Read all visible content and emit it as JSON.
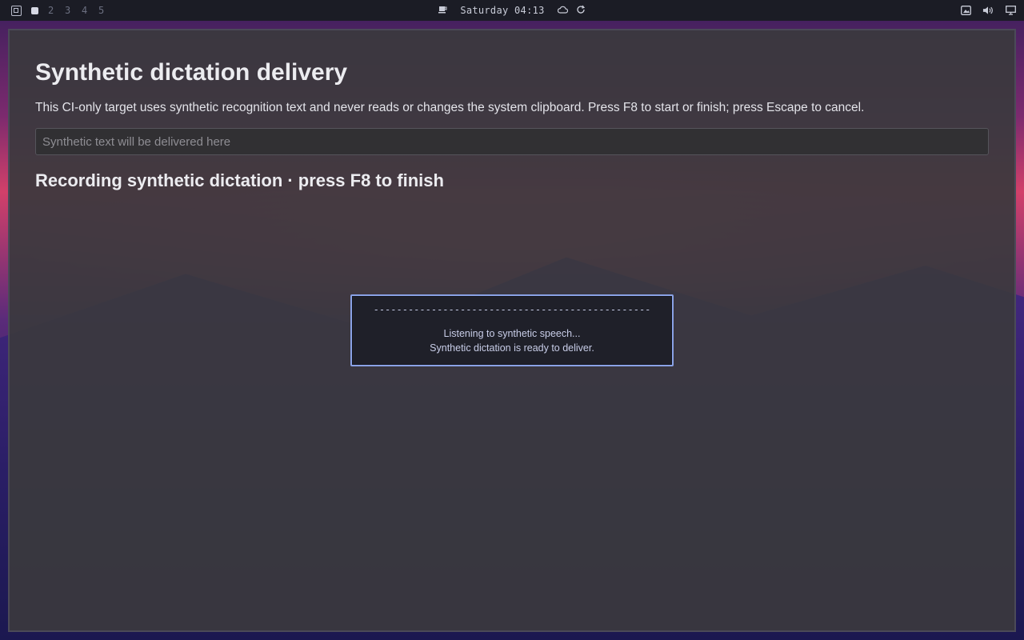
{
  "topbar": {
    "workspaces": [
      "2",
      "3",
      "4",
      "5"
    ],
    "clock": "Saturday 04:13"
  },
  "page": {
    "title": "Synthetic dictation delivery",
    "description": "This CI-only target uses synthetic recognition text and never reads or changes the system clipboard. Press F8 to start or finish; press Escape to cancel.",
    "input_placeholder": "Synthetic text will be delivered here",
    "input_value": "",
    "status": "Recording synthetic dictation · press F8 to finish"
  },
  "popup": {
    "meter": "------------------------------------------------",
    "line1": "Listening to synthetic speech...",
    "line2": "Synthetic dictation is ready to deliver."
  },
  "colors": {
    "popup_border": "#8aa2e6",
    "window_bg": "#3a393d",
    "panel_bg": "#1b1c25"
  }
}
